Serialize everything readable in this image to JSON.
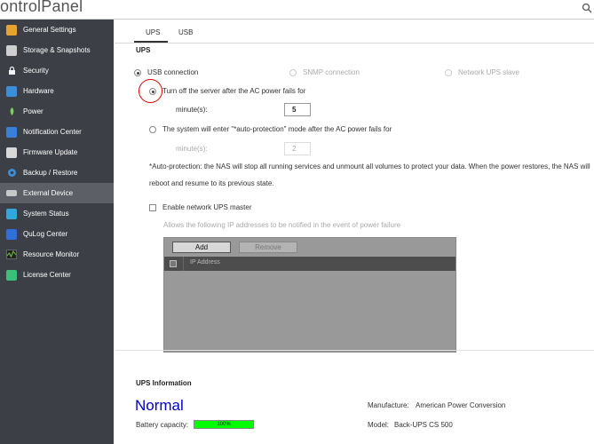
{
  "header": {
    "title_bold": "ontrol",
    "title_light": "Panel"
  },
  "sidebar": {
    "items": [
      {
        "label": "General Settings",
        "icon": "general-settings-icon",
        "color": "#e6a32e"
      },
      {
        "label": "Storage & Snapshots",
        "icon": "storage-icon",
        "color": "#cfcfcf"
      },
      {
        "label": "Security",
        "icon": "lock-icon",
        "color": "#f2f2f2"
      },
      {
        "label": "Hardware",
        "icon": "hardware-icon",
        "color": "#3a8fd8"
      },
      {
        "label": "Power",
        "icon": "power-icon",
        "color": "#7ccf5a"
      },
      {
        "label": "Notification Center",
        "icon": "notification-icon",
        "color": "#3a7fd8"
      },
      {
        "label": "Firmware Update",
        "icon": "firmware-icon",
        "color": "#d8d8d8"
      },
      {
        "label": "Backup / Restore",
        "icon": "backup-icon",
        "color": "#3a8fd8"
      },
      {
        "label": "External Device",
        "icon": "external-device-icon",
        "color": "#c8c8c8"
      },
      {
        "label": "System Status",
        "icon": "system-status-icon",
        "color": "#2fa8e0"
      },
      {
        "label": "QuLog Center",
        "icon": "qulog-icon",
        "color": "#2f6fd8"
      },
      {
        "label": "Resource Monitor",
        "icon": "resource-monitor-icon",
        "color": "#6cc44a"
      },
      {
        "label": "License Center",
        "icon": "license-icon",
        "color": "#3cbf7a"
      }
    ]
  },
  "tabs": [
    "UPS",
    "USB"
  ],
  "ups": {
    "section_title": "UPS",
    "mode_options": [
      "USB connection",
      "SNMP connection",
      "Network UPS slave"
    ],
    "option1_label": "Turn off the server after the AC power fails for",
    "option1_minutes_label": "minute(s):",
    "option1_minutes_value": "5",
    "option2_label": "The system will enter \"*auto-protection\" mode after the AC power fails for",
    "option2_minutes_label": "minute(s):",
    "option2_minutes_value": "2",
    "note_line1": "*Auto-protection: the NAS will stop all running services and unmount all volumes to protect your data. When the power restores, the NAS will",
    "note_line2": "reboot and resume to its previous state.",
    "network_master_label": "Enable network UPS master",
    "allow_label": "Allows the following IP addresses to be notified in the event of power failure",
    "add_button": "Add",
    "remove_button": "Remove",
    "ip_column": "IP Address"
  },
  "info": {
    "section_title": "UPS Information",
    "status": "Normal",
    "battery_label": "Battery capacity:",
    "battery_value": "100%",
    "battery_fraction": 1.0,
    "manufacture_label": "Manufacture:",
    "manufacture_value": "American Power Conversion",
    "model_label": "Model:",
    "model_value": "Back-UPS CS 500"
  }
}
